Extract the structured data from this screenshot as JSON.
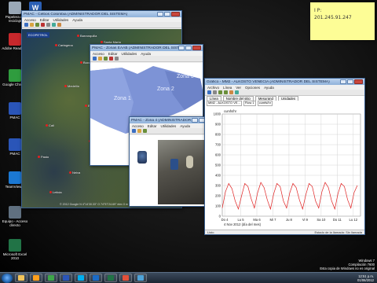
{
  "desktop": {
    "icons": [
      {
        "label": "Papelera de reciclaje",
        "color": "#9aa8b6"
      },
      {
        "label": "Adobe Reader X",
        "color": "#c8282c"
      },
      {
        "label": "Google Chrome",
        "color": "#2f9c3e"
      },
      {
        "label": "PMAC",
        "color": "#2a55b8"
      },
      {
        "label": "PMAC",
        "color": "#2a55b8"
      },
      {
        "label": "TeamViewer",
        "color": "#1b78d3"
      },
      {
        "label": "Equipo - Acceso directo",
        "color": "#607080"
      },
      {
        "label": "Microsoft Excel 2010",
        "color": "#217346"
      }
    ],
    "word_icon": {
      "label": "W",
      "color": "#2b5fb4"
    }
  },
  "windows": {
    "map": {
      "title": "PMAC - Celbos Colombia (ADMINISTRADOR DEL SISTEMA)",
      "menu": [
        "Acceso",
        "Editar",
        "Utilidades",
        "Ayuda"
      ],
      "side_tag": "ECOPETROL",
      "pins": [
        "Barranquilla",
        "Cartagena",
        "Medellín",
        "Bogotá",
        "Cali",
        "Cúcuta",
        "Bucaramanga",
        "Villavicencio",
        "Pasto",
        "Neiva",
        "Leticia",
        "Santa Marta"
      ],
      "footer": "© 2012 Google  N 4°14'30.33\" O 74°57'24.69\" elev 0 m"
    },
    "zones": {
      "title": "PMAC - Zonas EAAB (ADMINISTRADOR DEL SISTEMA)",
      "menu": [
        "Acceso",
        "Editar",
        "Utilidades",
        "Ayuda"
      ],
      "labels": [
        "Zona 1",
        "Zona 2",
        "Zona 3"
      ]
    },
    "zone4": {
      "title": "PMAC - Zona 4 (ADMINISTRADOR DEL SISTEMA)",
      "menu": [
        "Acceso",
        "Editar",
        "Utilidades",
        "Ayuda"
      ]
    },
    "graph": {
      "title": "Gráfico - MM2 - ALKOSTO VENECIA (ADMINISTRADOR DEL SISTEMA)",
      "menu": [
        "Archivo",
        "Línea",
        "Ver",
        "Opciones",
        "Ayuda"
      ],
      "tabs": [
        "Línea",
        "Nombre del sitio",
        "Mesurand",
        "Unidades"
      ],
      "fields": [
        "MM2 - ALKOSTO VE...",
        "Flow 1",
        "cumfs/hr"
      ],
      "status_left": "Listo",
      "status_right": "Estado de la llamada: Sin llamada"
    }
  },
  "sticky": {
    "line1": "I P:",
    "line2": "201.245.91.247"
  },
  "taskbar": {
    "items": [
      {
        "name": "explorer-task",
        "color": "#f2c45a"
      },
      {
        "name": "media-player-task",
        "color": "#ff9f1c"
      },
      {
        "name": "chrome-task",
        "color": "#3ea64a"
      },
      {
        "name": "pmac-task",
        "color": "#2a55b8"
      },
      {
        "name": "skype-task",
        "color": "#00aff0"
      },
      {
        "name": "outlook-task",
        "color": "#1b6bc6"
      },
      {
        "name": "excel-task",
        "color": "#217346"
      },
      {
        "name": "paint-task",
        "color": "#e2503a"
      },
      {
        "name": "chart-task",
        "color": "#4fa3d8"
      }
    ],
    "clock_time": "12:51 p.m.",
    "clock_date": "01/06/2012"
  },
  "watermark": {
    "line1": "Windows 7",
    "line2": "Compilación 7600",
    "line3": "Esta copia de Windows no es original"
  },
  "chart_data": {
    "type": "line",
    "ylabel": "cumfs/hr",
    "ylim": [
      0,
      1000
    ],
    "yticks": [
      0,
      100,
      200,
      300,
      400,
      500,
      600,
      700,
      800,
      900,
      1000
    ],
    "xticks": [
      "Do 4",
      "Lu 5",
      "Ma 6",
      "Mi 7",
      "Ju 8",
      "Vi 9",
      "Sa 10",
      "Do 11",
      "Lu 12"
    ],
    "xlabel": "4 Nov 2012 (día del mes)",
    "series": [
      {
        "color": "#e02020",
        "x": [
          0.0,
          0.2,
          0.4,
          0.6,
          0.8,
          1.0,
          1.2,
          1.4,
          1.6,
          1.8,
          2.0,
          2.2,
          2.4,
          2.6,
          2.8,
          3.0,
          3.2,
          3.4,
          3.6,
          3.8,
          4.0,
          4.2,
          4.4,
          4.6,
          4.8,
          5.0,
          5.2,
          5.4,
          5.6,
          5.8,
          6.0,
          6.2,
          6.4,
          6.6,
          6.8,
          7.0,
          7.2,
          7.4,
          7.6,
          7.8,
          8.0,
          8.2,
          8.4
        ],
        "values": [
          80,
          240,
          320,
          270,
          150,
          70,
          200,
          320,
          290,
          170,
          80,
          230,
          330,
          280,
          160,
          70,
          220,
          320,
          290,
          150,
          80,
          230,
          320,
          280,
          160,
          70,
          210,
          320,
          290,
          150,
          80,
          240,
          330,
          280,
          150,
          70,
          220,
          320,
          290,
          160,
          80,
          230,
          300
        ]
      }
    ]
  }
}
